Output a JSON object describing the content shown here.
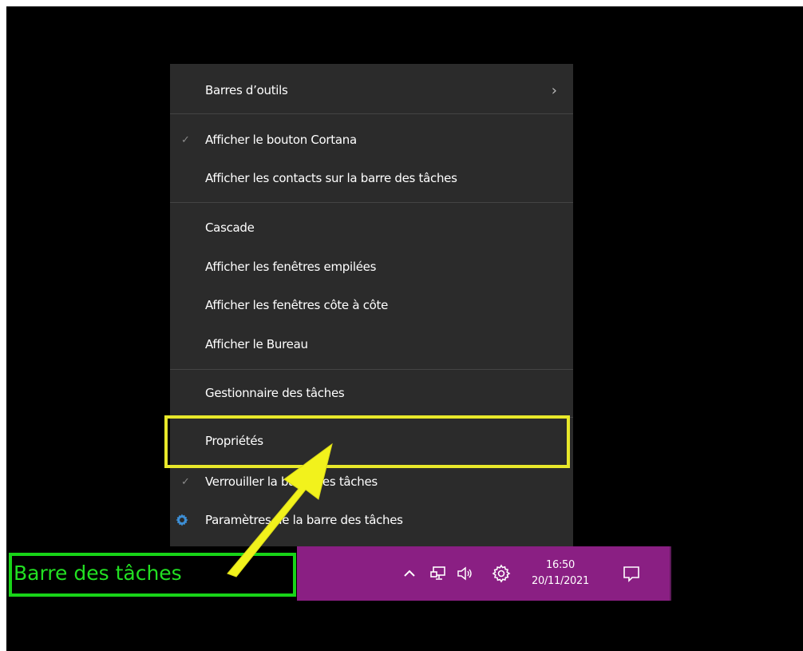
{
  "context_menu": {
    "items": [
      {
        "label": "Barres d’outils",
        "checked": false,
        "submenu": true
      },
      {
        "label": "Afficher le bouton Cortana",
        "checked": true
      },
      {
        "label": "Afficher les contacts sur la barre des tâches",
        "checked": false
      },
      {
        "label": "Cascade",
        "checked": false
      },
      {
        "label": "Afficher les fenêtres empilées",
        "checked": false
      },
      {
        "label": "Afficher les fenêtres côte à côte",
        "checked": false
      },
      {
        "label": "Afficher le Bureau",
        "checked": false
      },
      {
        "label": "Gestionnaire des tâches",
        "checked": false
      },
      {
        "label": "Propriétés",
        "checked": false,
        "highlighted": true
      },
      {
        "label": "Verrouiller la barre des tâches",
        "checked": true
      },
      {
        "label": "Paramètres de la barre des tâches",
        "checked": false,
        "icon": "gear-icon"
      }
    ],
    "check_glyph": "✓",
    "submenu_glyph": "›"
  },
  "taskbar": {
    "time": "16:50",
    "date": "20/11/2021",
    "color": "#8a1f83",
    "tray_icons": [
      "chevron-up-icon",
      "network-icon",
      "volume-icon",
      "settings-icon",
      "notification-icon"
    ]
  },
  "annotations": {
    "taskbar_label": "Barre des tâches",
    "green": "#18d418",
    "yellow": "#e8e82a"
  }
}
